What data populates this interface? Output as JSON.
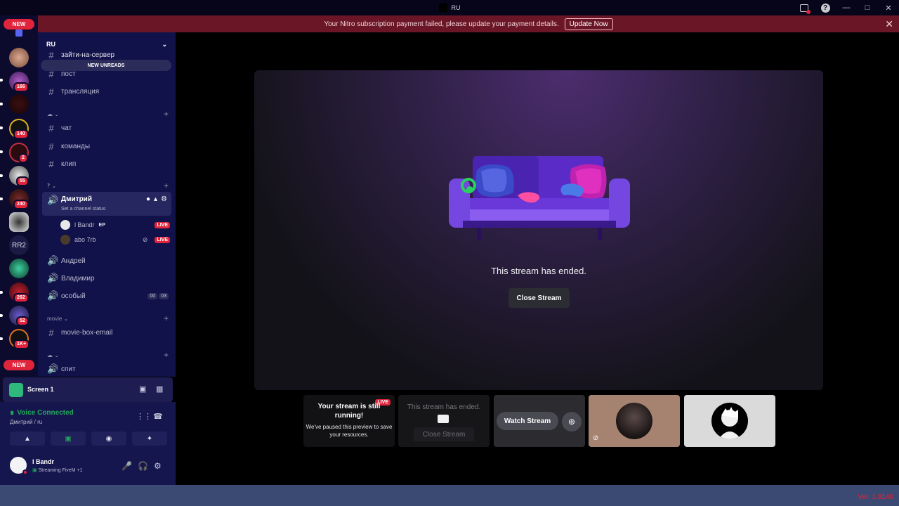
{
  "titlebar": {
    "title": "RU"
  },
  "notice": {
    "message": "Your Nitro subscription payment failed, please update your payment details.",
    "button": "Update Now"
  },
  "rail": {
    "new_top": "NEW",
    "new_bottom": "NEW",
    "badges": [
      "166",
      "140",
      "2",
      "55",
      "240",
      "262",
      "52",
      "1K+"
    ],
    "text_server": "RR2"
  },
  "sidebar": {
    "server_name": "RU",
    "new_unreads": "NEW UNREADS",
    "partial_channel": "зайти-на-сервер",
    "channels_top": [
      "пост",
      "трансляция"
    ],
    "channels_mid": [
      "чат",
      "команды",
      "клип"
    ],
    "voice_active": {
      "name": "Дмитрий",
      "status": "Set a channel status",
      "users": [
        {
          "name": "l Bandr",
          "tag": "EP",
          "live": "LIVE"
        },
        {
          "name": "abo 7rb",
          "live": "LIVE"
        }
      ]
    },
    "voice_channels": [
      "Андрей",
      "Владимир",
      "особый"
    ],
    "osobiy_counts": [
      "00",
      "03"
    ],
    "category_movie": "movie",
    "movie_channel": "movie-box-email",
    "last_channel": "спит"
  },
  "screenshare": {
    "label": "Screen 1"
  },
  "voice": {
    "status": "Voice Connected",
    "location": "Дмитрий / ru"
  },
  "user": {
    "name": "l Bandr",
    "status": "Streaming FiveM",
    "extra": "+1"
  },
  "stage": {
    "ended_text": "This stream has ended.",
    "close_button": "Close Stream"
  },
  "tiles": {
    "own": {
      "title": "Your stream is still running!",
      "subtitle": "We've paused this preview to save your resources.",
      "live": "LIVE"
    },
    "ended": {
      "title": "This stream has ended.",
      "button": "Close Stream"
    },
    "watch": {
      "button": "Watch Stream"
    }
  },
  "footer": {
    "version": "Ver. 1.9140"
  },
  "colors": {
    "accent_red": "#e0243c",
    "connected_green": "#23a55a",
    "sidebar_bg": "#12124a"
  }
}
